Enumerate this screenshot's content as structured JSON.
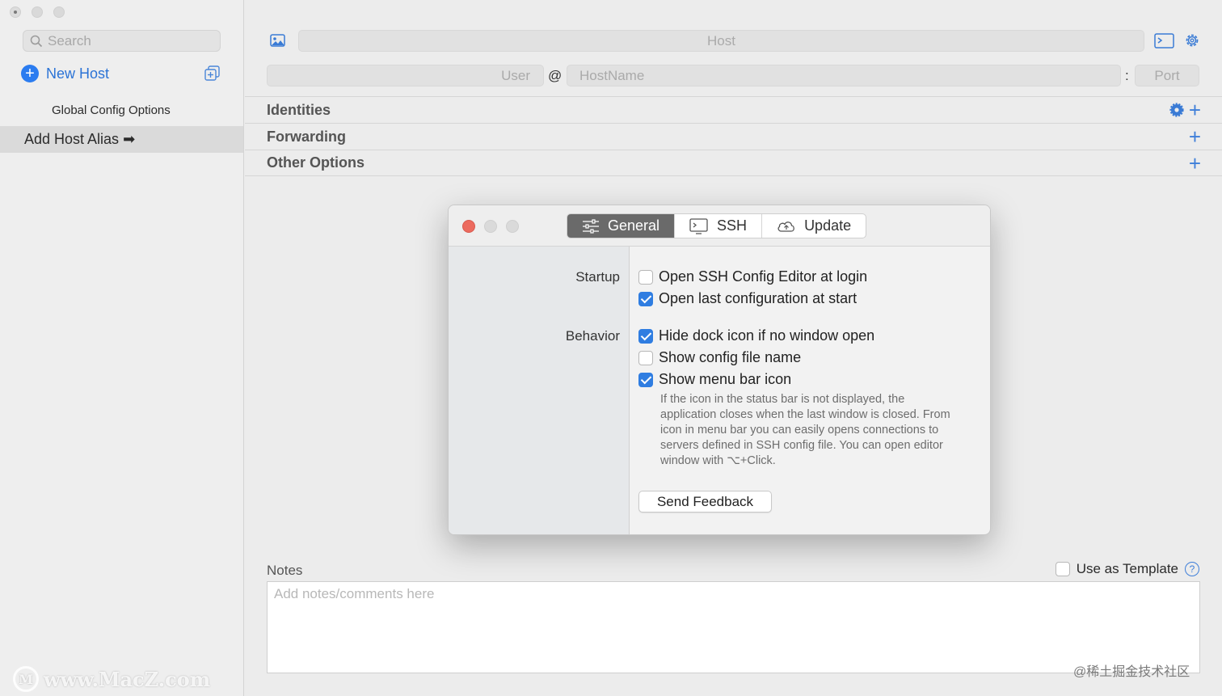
{
  "sidebar": {
    "search_placeholder": "Search",
    "new_host_label": "New Host",
    "global_config_label": "Global Config Options",
    "alias_row_label": "Add Host Alias ➡"
  },
  "header": {
    "host_placeholder": "Host",
    "user_placeholder": "User",
    "at_symbol": "@",
    "hostname_placeholder": "HostName",
    "colon_symbol": ":",
    "port_placeholder": "Port"
  },
  "sections": {
    "identities": "Identities",
    "forwarding": "Forwarding",
    "other_options": "Other Options"
  },
  "notes": {
    "label": "Notes",
    "placeholder": "Add notes/comments here",
    "use_as_template": "Use as Template",
    "help_glyph": "?"
  },
  "dialog": {
    "tabs": [
      {
        "label": "General",
        "icon": "sliders-icon",
        "active": true
      },
      {
        "label": "SSH",
        "icon": "terminal-window-icon",
        "active": false
      },
      {
        "label": "Update",
        "icon": "cloud-icon",
        "active": false
      }
    ],
    "startup_label": "Startup",
    "behavior_label": "Behavior",
    "options": {
      "open_editor_login": {
        "label": "Open SSH Config Editor at login",
        "checked": false
      },
      "open_last_config": {
        "label": "Open last configuration at start",
        "checked": true
      },
      "hide_dock_icon": {
        "label": "Hide dock icon if no window open",
        "checked": true
      },
      "show_config_file": {
        "label": "Show config file name",
        "checked": false
      },
      "show_menu_bar_icon": {
        "label": "Show menu bar icon",
        "checked": true
      }
    },
    "description": "If the icon in the status bar is not displayed, the application closes when the last window is closed. From icon in menu bar you can easily opens connections to servers defined in SSH config file. You can open editor window with ⌥+Click.",
    "send_feedback": "Send Feedback"
  },
  "watermarks": {
    "left_text": "www.MacZ.com",
    "left_logo_letter": "M",
    "right_text": "@稀土掘金技术社区"
  },
  "colors": {
    "accent": "#2f7de1",
    "close_red": "#ec6a5e",
    "active_tab": "#6a6a6a"
  }
}
